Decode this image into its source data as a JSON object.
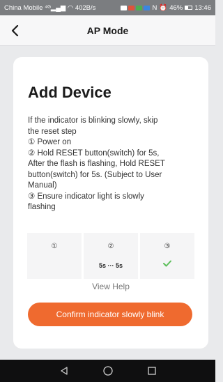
{
  "status_bar": {
    "carrier": "China Mobile",
    "speed": "402B/s",
    "battery": "46%",
    "time": "13:46"
  },
  "header": {
    "title": "AP Mode"
  },
  "card": {
    "title": "Add Device",
    "instructions": [
      "If the indicator is blinking slowly, skip",
      "the reset step",
      "① Power on",
      "② Hold RESET button(switch) for 5s,",
      "After the flash is flashing, Hold RESET",
      "button(switch) for 5s. (Subject to User",
      "Manual)",
      "③ Ensure indicator light is slowly",
      "flashing"
    ],
    "steps": [
      {
        "num": "①"
      },
      {
        "num": "②",
        "time": "5s ··· 5s"
      },
      {
        "num": "③"
      }
    ],
    "view_help": "View Help",
    "confirm_label": "Confirm indicator slowly blink"
  },
  "colors": {
    "accent": "#ef6a2f",
    "check": "#5cbf5a"
  }
}
